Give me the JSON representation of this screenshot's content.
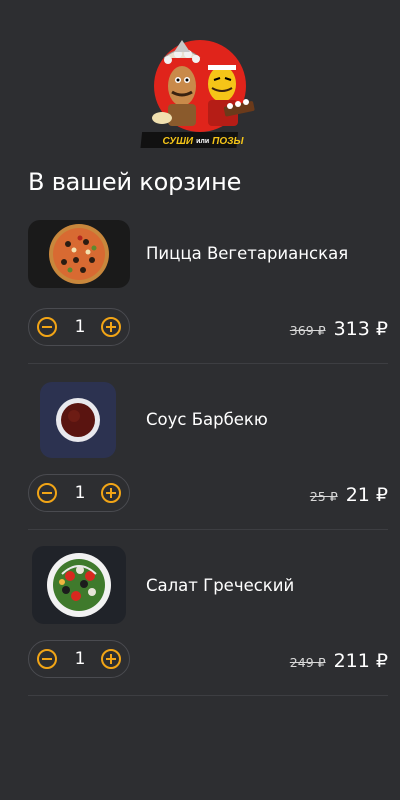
{
  "brand": {
    "logo_text_left": "СУШИ",
    "logo_text_mid": "или",
    "logo_text_right": "ПОЗЫ",
    "colors": {
      "red": "#e0241b",
      "yellow": "#f5c518",
      "dark": "#1c1c1c"
    }
  },
  "cart": {
    "title": "В вашей корзине",
    "items": [
      {
        "name": "Пицца Вегетарианская",
        "quantity": "1",
        "old_price": "369 ₽",
        "price": "313 ₽",
        "image": "pizza-image"
      },
      {
        "name": "Соус Барбекю",
        "quantity": "1",
        "old_price": "25 ₽",
        "price": "21 ₽",
        "image": "sauce-image"
      },
      {
        "name": "Салат Греческий",
        "quantity": "1",
        "old_price": "249 ₽",
        "price": "211 ₽",
        "image": "salad-image"
      }
    ]
  },
  "theme": {
    "background": "#2d2e31",
    "accent": "#f2a516",
    "divider": "#3d3e42"
  }
}
